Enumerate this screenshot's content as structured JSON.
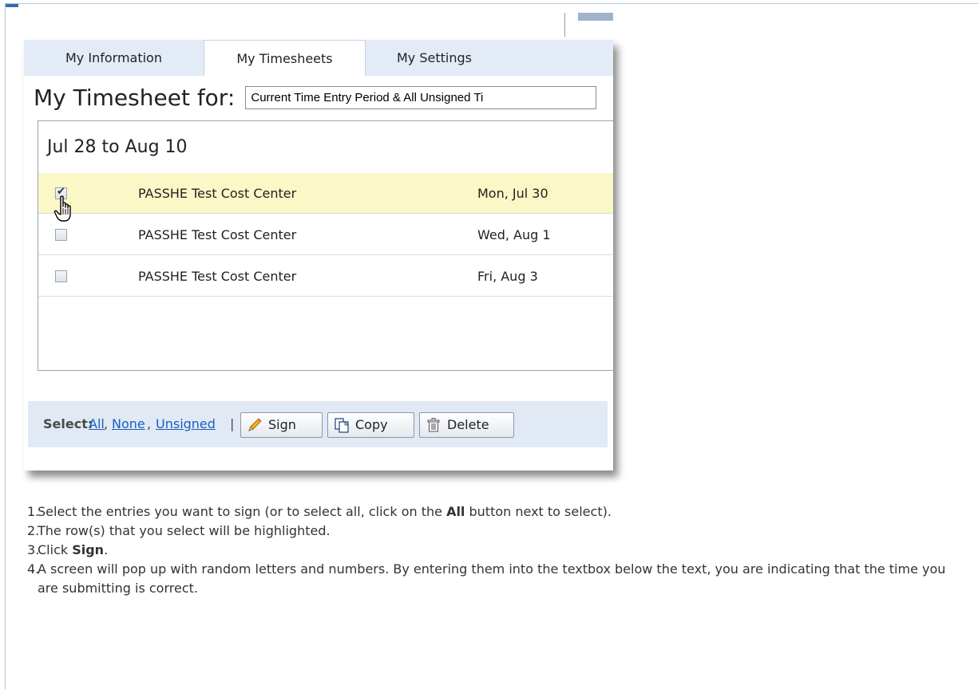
{
  "tabs": [
    {
      "label": "My Information",
      "active": false
    },
    {
      "label": "My Timesheets",
      "active": true
    },
    {
      "label": "My Settings",
      "active": false
    }
  ],
  "timesheet": {
    "title": "My Timesheet for:",
    "period_value": "Current Time Entry Period & All Unsigned Ti",
    "period_heading": "Jul 28 to Aug 10",
    "rows": [
      {
        "cost_center": "PASSHE Test Cost Center",
        "date": "Mon, Jul 30",
        "checked": true
      },
      {
        "cost_center": "PASSHE Test Cost Center",
        "date": "Wed, Aug 1",
        "checked": false
      },
      {
        "cost_center": "PASSHE Test Cost Center",
        "date": "Fri, Aug 3",
        "checked": false
      }
    ]
  },
  "actions": {
    "select_label": "Select:",
    "links": [
      "All",
      "None",
      "Unsigned"
    ],
    "link_separators": [
      ",",
      ",",
      "|"
    ],
    "sign": "Sign",
    "copy": "Copy",
    "delete": "Delete"
  },
  "instructions": {
    "steps": [
      {
        "num": "1.",
        "parts": [
          "Select the entries you want to sign (or to select all, click on the ",
          "All",
          " button next to select)."
        ]
      },
      {
        "num": "2.",
        "parts": [
          "The row(s) that you select will be highlighted."
        ]
      },
      {
        "num": "3.",
        "parts": [
          "Click ",
          "Sign",
          "."
        ]
      },
      {
        "num": "4.",
        "parts": [
          "A screen will pop up with random letters and numbers. By entering them into the textbox below the text, you are indicating that the time you are submitting is correct."
        ]
      }
    ]
  },
  "colors": {
    "tabbar": "#e3ebf6",
    "selected_row": "#fcf7c6",
    "link": "#1a5fc0",
    "action_bar": "#e1e9f4"
  },
  "icons": {
    "cursor": "hand-pointer-icon",
    "sign": "pencil-icon",
    "copy": "copy-pages-icon",
    "delete": "trash-can-icon"
  }
}
